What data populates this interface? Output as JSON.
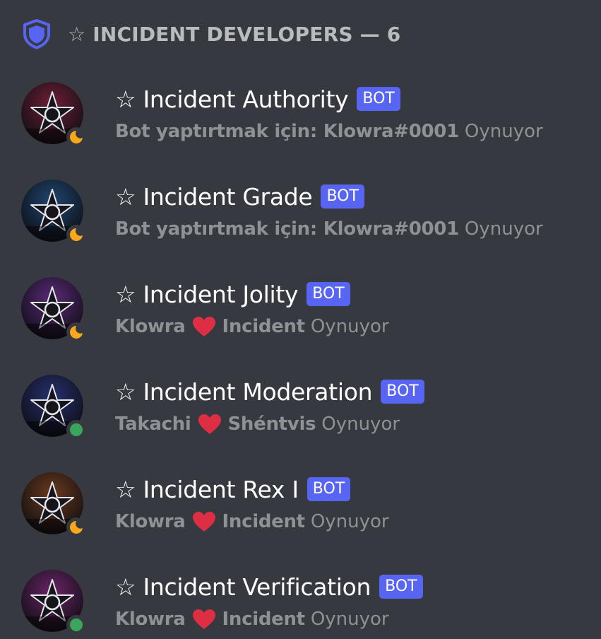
{
  "header": {
    "title": "☆ INCIDENT DEVELOPERS — 6",
    "icon": "shield-icon",
    "accent": "#5865f2"
  },
  "colors": {
    "background": "#36393f",
    "bot_tag": "#5865f2",
    "idle": "#faa81a",
    "online": "#3ba55d",
    "heart": "#dd2e44"
  },
  "members": [
    {
      "name": "☆ Incident Authority",
      "tag": "BOT",
      "activity_left": "Bot yaptırtmak için: Klowra#0001",
      "activity_right": "",
      "activity_verb": "Oynuyor",
      "status": "idle",
      "avatar_tint": "#6e1f35"
    },
    {
      "name": "☆ Incident Grade",
      "tag": "BOT",
      "activity_left": "Bot yaptırtmak için: Klowra#0001",
      "activity_right": "",
      "activity_verb": "Oynuyor",
      "status": "idle",
      "avatar_tint": "#1f4670"
    },
    {
      "name": "☆ Incident Jolity",
      "tag": "BOT",
      "activity_left": "Klowra",
      "activity_right": "Incident",
      "activity_verb": "Oynuyor",
      "status": "idle",
      "avatar_tint": "#5a2a78"
    },
    {
      "name": "☆ Incident Moderation",
      "tag": "BOT",
      "activity_left": "Takachi",
      "activity_right": "Shéntvis",
      "activity_verb": "Oynuyor",
      "status": "online",
      "avatar_tint": "#26306e"
    },
    {
      "name": "☆ Incident Rex I",
      "tag": "BOT",
      "activity_left": "Klowra",
      "activity_right": "Incident",
      "activity_verb": "Oynuyor",
      "status": "idle",
      "avatar_tint": "#6b3a1c"
    },
    {
      "name": "☆ Incident Verification",
      "tag": "BOT",
      "activity_left": "Klowra",
      "activity_right": "Incident",
      "activity_verb": "Oynuyor",
      "status": "online",
      "avatar_tint": "#6a2466"
    }
  ]
}
